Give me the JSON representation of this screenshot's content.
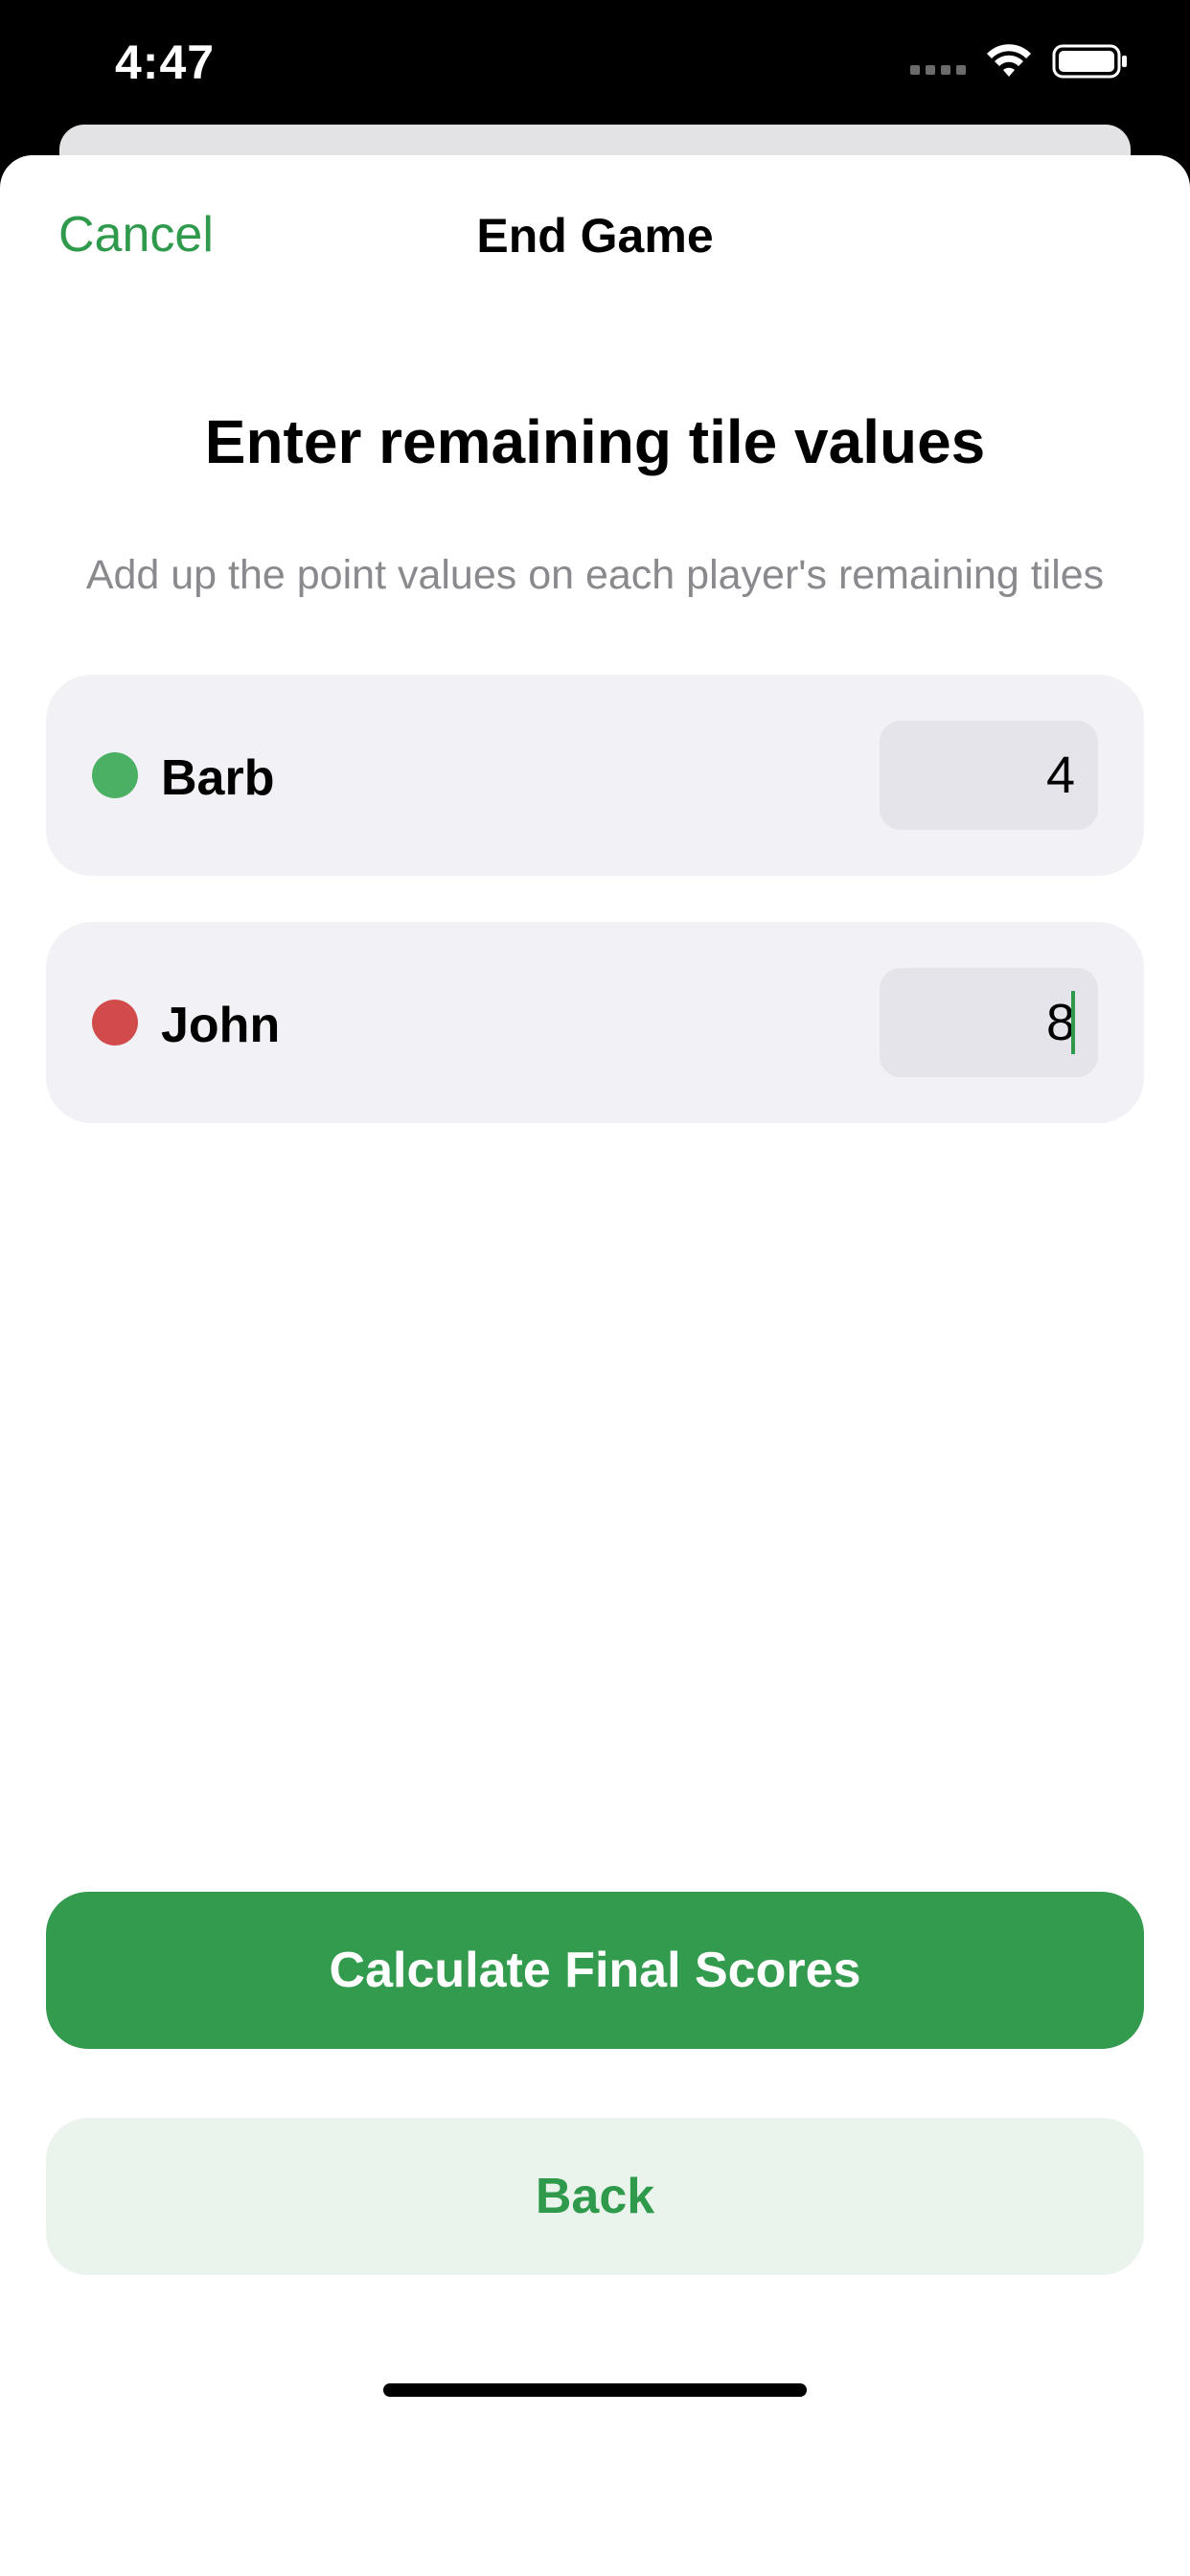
{
  "status_bar": {
    "time": "4:47",
    "icons": [
      "cellular-dots-icon",
      "wifi-icon",
      "battery-icon"
    ]
  },
  "nav": {
    "cancel_label": "Cancel",
    "title": "End Game"
  },
  "content": {
    "heading": "Enter remaining tile values",
    "subheading": "Add up the point values on each player's remaining tiles"
  },
  "players": [
    {
      "name": "Barb",
      "value": "4",
      "color": "#4cb064"
    },
    {
      "name": "John",
      "value": "8",
      "color": "#d14b4b"
    }
  ],
  "actions": {
    "primary_label": "Calculate Final Scores",
    "secondary_label": "Back"
  },
  "colors": {
    "accent": "#2f9a4b",
    "primary_button": "#339b4e",
    "secondary_button_bg": "#eaf4ec"
  }
}
